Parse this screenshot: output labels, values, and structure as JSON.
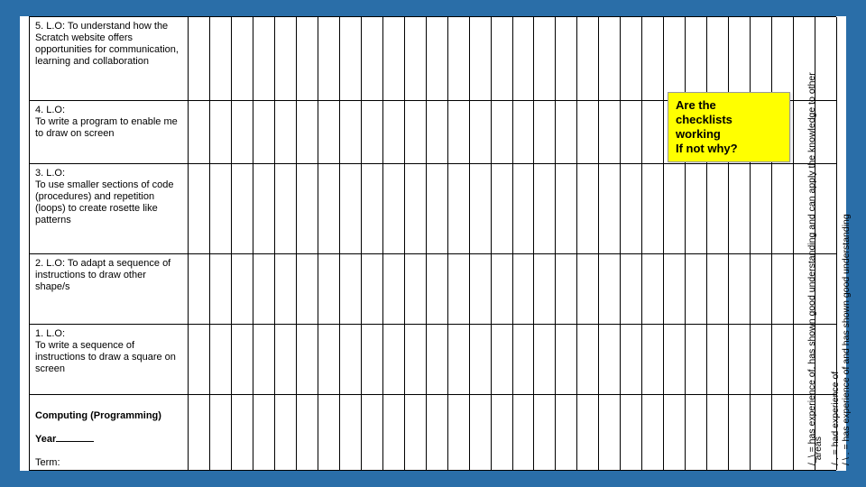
{
  "rows": {
    "r5": "5. L.O: To understand how the Scratch website offers opportunities for communication, learning and collaboration",
    "r4a": "4. L.O:",
    "r4b": "To write a program to enable me to draw on screen",
    "r3a": "3. L.O:",
    "r3b": "To use smaller sections of code (procedures) and repetition (loops) to create rosette like patterns",
    "r2a": "2. L.O: To adapt a sequence of",
    "r2b": "instructions to draw other shape/s",
    "r1a": "1. L.O:",
    "r1b": "To write a sequence of instructions to draw a square on screen"
  },
  "header": {
    "title": "Computing (Programming)",
    "year_label": "Year",
    "term_label": "Term:"
  },
  "sticky": {
    "l1": "Are the",
    "l2": "checklists",
    "l3": "working",
    "l4": "If not why?"
  },
  "legend": {
    "line1": "/ . = had experience of",
    "line2": "/ \\ . = has experience of and has shown good understanding",
    "line3": "/_\\ = has experience of, has shown good understanding and can apply the knowledge to other",
    "areas": "areas"
  },
  "grid": {
    "cols": 30
  }
}
